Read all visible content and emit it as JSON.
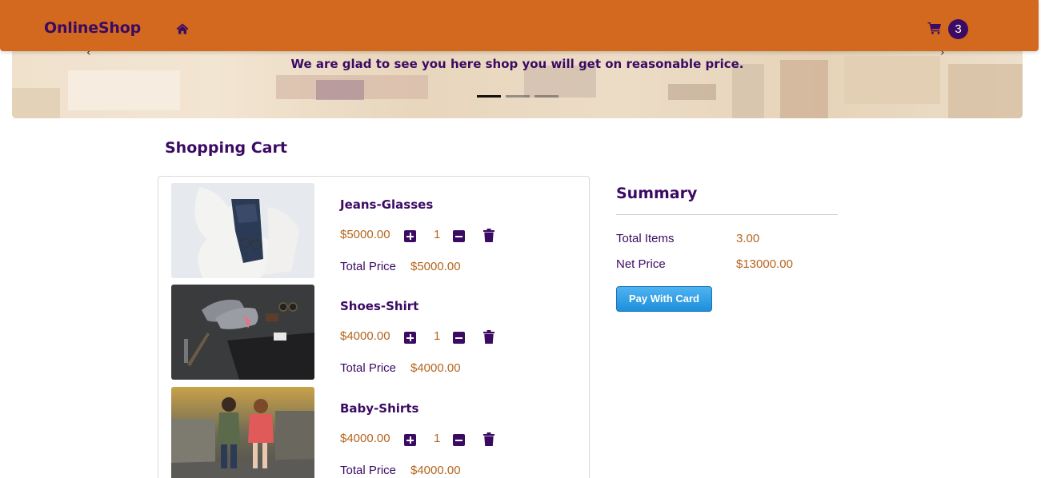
{
  "navbar": {
    "brand": "OnlineShop",
    "cart_count": "3",
    "color": "#d2691e"
  },
  "carousel": {
    "caption": "We are glad to see you here shop you will get on reasonable price.",
    "prev_arrow": "‹",
    "next_arrow": "›",
    "indicators": 3,
    "active_index": 0
  },
  "cart": {
    "heading": "Shopping Cart",
    "items": [
      {
        "name": "Jeans-Glasses",
        "price": "$5000.00",
        "quantity": "1",
        "total_label": "Total Price",
        "total": "$5000.00"
      },
      {
        "name": "Shoes-Shirt",
        "price": "$4000.00",
        "quantity": "1",
        "total_label": "Total Price",
        "total": "$4000.00"
      },
      {
        "name": "Baby-Shirts",
        "price": "$4000.00",
        "quantity": "1",
        "total_label": "Total Price",
        "total": "$4000.00"
      }
    ]
  },
  "summary": {
    "title": "Summary",
    "total_items_label": "Total Items",
    "total_items_value": "3.00",
    "net_price_label": "Net Price",
    "net_price_value": "$13000.00",
    "pay_button": "Pay With Card"
  },
  "colors": {
    "primary": "#3b0a63",
    "accent": "#b5651d",
    "pay_button": "#1e8fdc"
  },
  "icons": [
    "home-icon",
    "cart-icon",
    "plus-icon",
    "minus-icon",
    "trash-icon"
  ]
}
